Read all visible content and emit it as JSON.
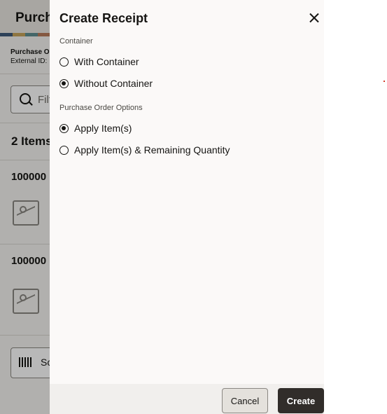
{
  "background": {
    "header_title": "Purcha",
    "po_line1": "Purchase O",
    "po_line2": "External ID:",
    "filter_placeholder": "Filt",
    "items_count": "2 Items",
    "rows": [
      {
        "id": "100000"
      },
      {
        "id": "100000"
      }
    ],
    "scan_label": "Sc"
  },
  "drawer": {
    "title": "Create Receipt",
    "container_section": {
      "label": "Container",
      "options": [
        {
          "label": "With Container",
          "checked": false
        },
        {
          "label": "Without Container",
          "checked": true
        }
      ]
    },
    "po_options_section": {
      "label": "Purchase Order Options",
      "options": [
        {
          "label": "Apply Item(s)",
          "checked": true
        },
        {
          "label": "Apply Item(s) & Remaining Quantity",
          "checked": false
        }
      ]
    },
    "footer": {
      "cancel_label": "Cancel",
      "create_label": "Create"
    }
  }
}
